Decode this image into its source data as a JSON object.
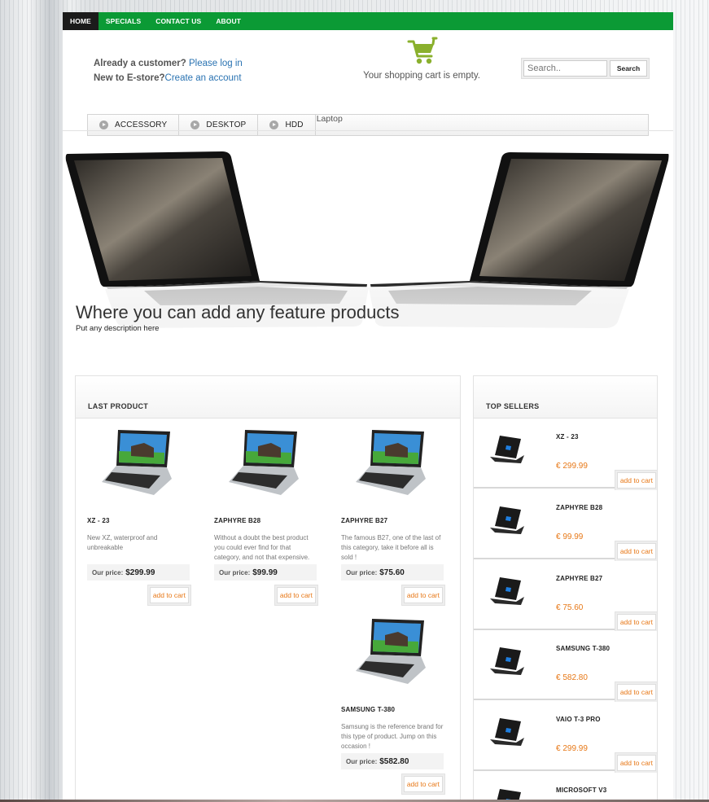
{
  "nav": [
    "HOME",
    "SPECIALS",
    "CONTACT US",
    "ABOUT"
  ],
  "account": {
    "customer_text": "Already a customer?",
    "login_link": "Please log in",
    "new_text": "New to E-store?",
    "create_link": "Create an account"
  },
  "cart": {
    "message": "Your shopping cart is empty."
  },
  "search": {
    "placeholder": "Search..",
    "button": "Search"
  },
  "categories": [
    "ACCESSORY",
    "DESKTOP",
    "HDD"
  ],
  "category_extra": "Laptop",
  "banner": {
    "title": "Where you can add any feature products",
    "description": "Put any description here"
  },
  "last_product": {
    "title": "LAST PRODUCT",
    "price_label": "Our price:",
    "add_to_cart": "add to cart",
    "items": [
      {
        "name": "XZ - 23",
        "desc": "New XZ, waterproof and unbreakable",
        "price": "$299.99"
      },
      {
        "name": "ZAPHYRE B28",
        "desc": "Without a doubt the best product you could ever find for that category, and not that expensive.",
        "price": "$99.99"
      },
      {
        "name": "ZAPHYRE B27",
        "desc": "The famous B27, one of the last of this category, take it before all is sold !",
        "price": "$75.60"
      },
      {
        "name": "SAMSUNG T-380",
        "desc": "Samsung is the reference brand for this type of product. Jump on this occasion !",
        "price": "$582.80"
      }
    ]
  },
  "top_sellers": {
    "title": "TOP SELLERS",
    "add_to_cart": "add to cart",
    "items": [
      {
        "name": "XZ - 23",
        "price": "€ 299.99"
      },
      {
        "name": "ZAPHYRE B28",
        "price": "€ 99.99"
      },
      {
        "name": "ZAPHYRE B27",
        "price": "€ 75.60"
      },
      {
        "name": "SAMSUNG T-380",
        "price": "€ 582.80"
      },
      {
        "name": "VAIO T-3 PRO",
        "price": "€ 299.99"
      },
      {
        "name": "MICROSOFT V3",
        "price": ""
      }
    ]
  },
  "colors": {
    "nav_green": "#0b9a35",
    "link_blue": "#2a73b2",
    "price_orange": "#e77817"
  }
}
